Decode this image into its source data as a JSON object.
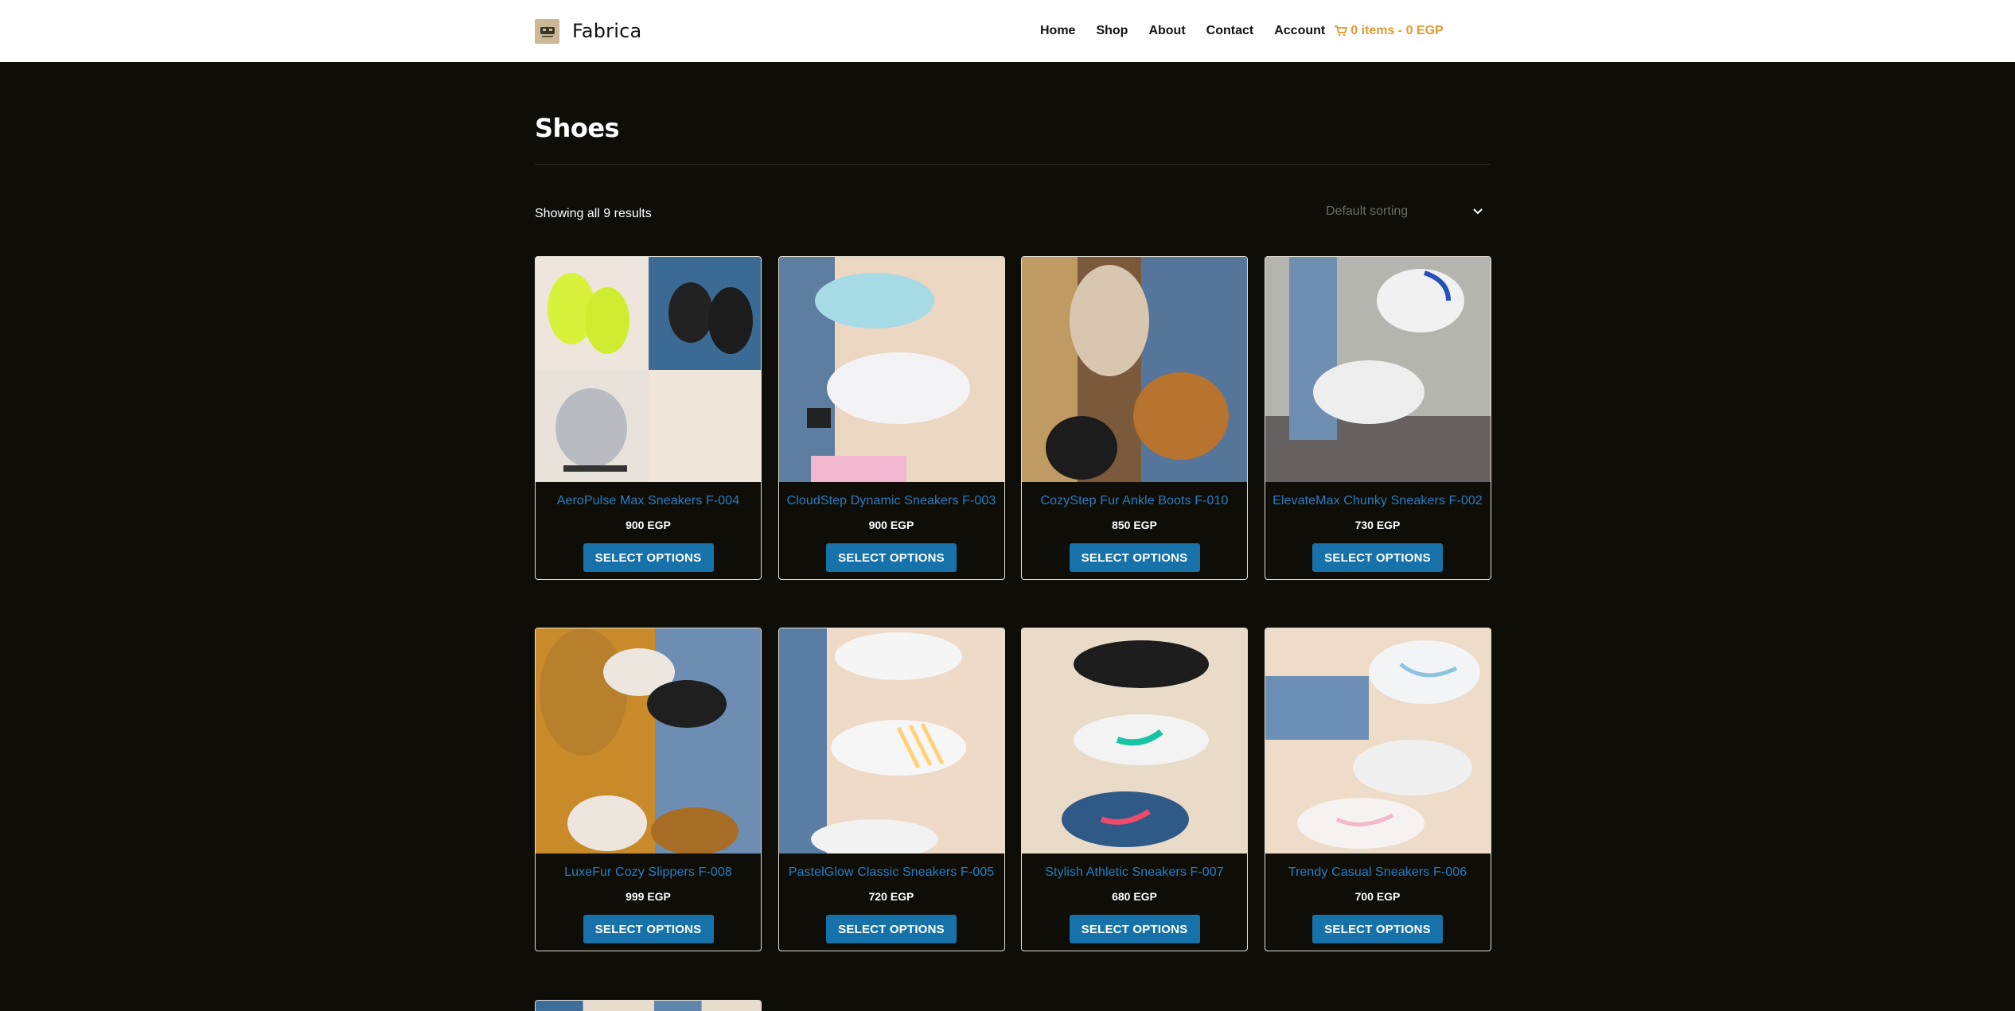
{
  "header": {
    "brand": "Fabrica",
    "nav": [
      "Home",
      "Shop",
      "About",
      "Contact",
      "Account"
    ],
    "cart": "0 items - 0 EGP",
    "colors": {
      "cart": "#e09a32",
      "link": "#2a7dc0",
      "button": "#1672a9"
    }
  },
  "page": {
    "title": "Shoes",
    "result_count": "Showing all 9 results",
    "sorting": "Default sorting"
  },
  "products": [
    {
      "name": "AeroPulse Max Sneakers F-004",
      "price": "900 EGP",
      "button": "SELECT OPTIONS"
    },
    {
      "name": "CloudStep Dynamic Sneakers F-003",
      "price": "900 EGP",
      "button": "SELECT OPTIONS"
    },
    {
      "name": "CozyStep Fur Ankle Boots F-010",
      "price": "850 EGP",
      "button": "SELECT OPTIONS"
    },
    {
      "name": "ElevateMax Chunky Sneakers F-002",
      "price": "730 EGP",
      "button": "SELECT OPTIONS"
    },
    {
      "name": "LuxeFur Cozy Slippers F-008",
      "price": "999 EGP",
      "button": "SELECT OPTIONS"
    },
    {
      "name": "PastelGlow Classic Sneakers F-005",
      "price": "720 EGP",
      "button": "SELECT OPTIONS"
    },
    {
      "name": "Stylish Athletic Sneakers F-007",
      "price": "680 EGP",
      "button": "SELECT OPTIONS"
    },
    {
      "name": "Trendy Casual Sneakers F-006",
      "price": "700 EGP",
      "button": "SELECT OPTIONS"
    }
  ]
}
